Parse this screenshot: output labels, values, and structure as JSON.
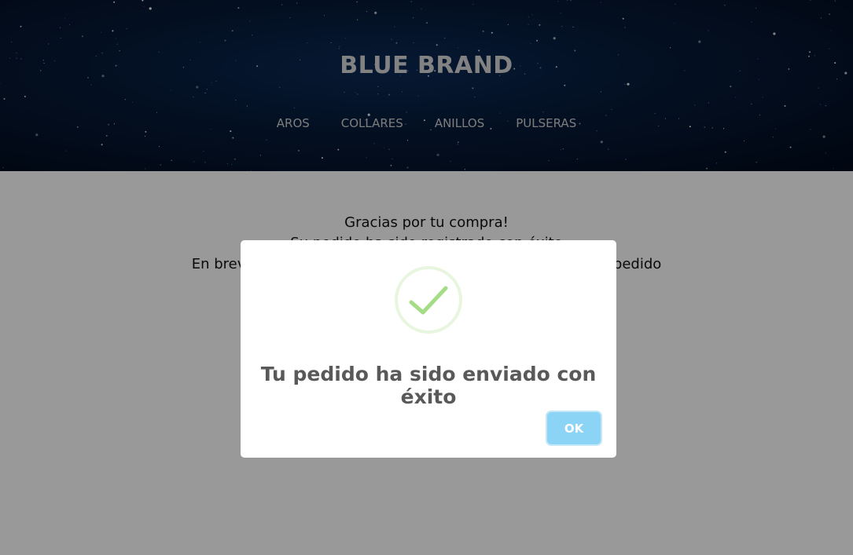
{
  "header": {
    "brand": "BLUE BRAND",
    "nav": [
      {
        "label": "AROS"
      },
      {
        "label": "COLLARES"
      },
      {
        "label": "ANILLOS"
      },
      {
        "label": "PULSERAS"
      }
    ]
  },
  "main": {
    "line1": "Gracias por tu compra!",
    "line2": "Su pedido ha sido registrado con éxito",
    "line3": "En breve te enviaremos un correo con la información de tu pedido"
  },
  "modal": {
    "icon": "checkmark-icon",
    "title": "Tu pedido ha sido enviado con éxito",
    "ok_label": "OK"
  },
  "colors": {
    "header_bg": "#061a38",
    "overlay": "rgba(0,0,0,0.4)",
    "ok_button": "#8cd4f5",
    "success": "#a5dc86"
  }
}
